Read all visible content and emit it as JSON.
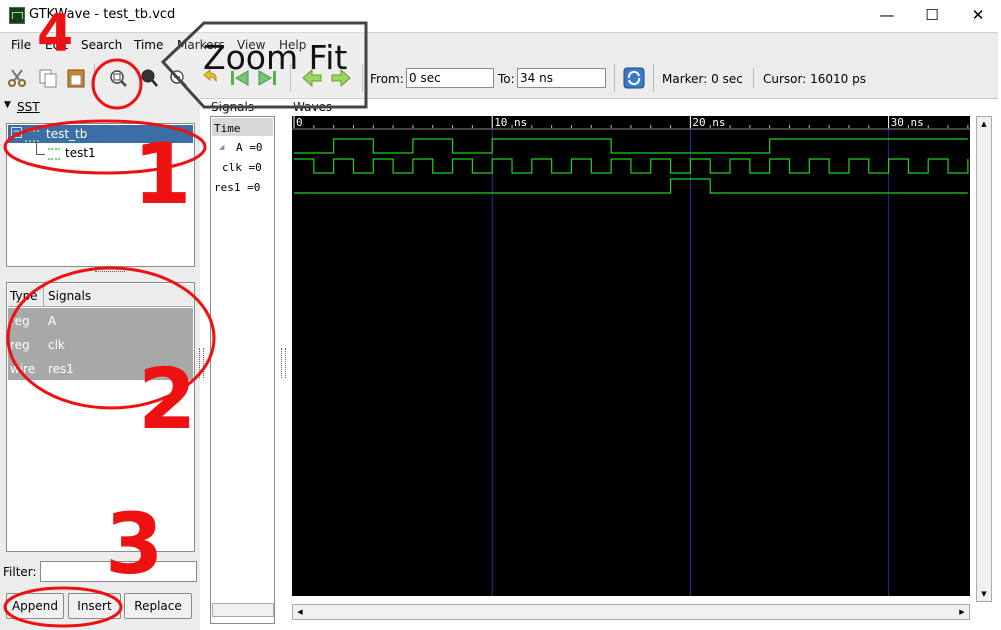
{
  "window": {
    "title": "GTKWave - test_tb.vcd",
    "controls": [
      "—",
      "☐",
      "✕"
    ]
  },
  "menu": [
    "File",
    "Edit",
    "Search",
    "Time",
    "Markers",
    "View",
    "Help"
  ],
  "toolbar": {
    "from_label": "From:",
    "from_value": "0 sec",
    "to_label": "To:",
    "to_value": "34 ns",
    "marker_text": "Marker: 0 sec",
    "cursor_text": "Cursor: 16010 ps",
    "icons": [
      "cut-icon",
      "copy-icon",
      "paste-icon",
      "zoom-fit-icon",
      "zoom-in-icon",
      "zoom-out-icon",
      "undo-icon",
      "zoom-start-icon",
      "zoom-end-icon",
      "prev-edge-icon",
      "next-edge-icon",
      "reload-icon"
    ]
  },
  "sst": {
    "header": "SST",
    "tree": [
      {
        "label": "test_tb",
        "selected": true
      },
      {
        "label": "test1",
        "selected": false
      }
    ],
    "columns": {
      "type": "Type",
      "signals": "Signals"
    },
    "signals": [
      {
        "type": "reg",
        "name": "A"
      },
      {
        "type": "reg",
        "name": "clk"
      },
      {
        "type": "wire",
        "name": "res1"
      }
    ],
    "filter_label": "Filter:",
    "filter_value": "",
    "buttons": {
      "append": "Append",
      "insert": "Insert",
      "replace": "Replace"
    }
  },
  "signals_pane": {
    "header": "Signals",
    "rows": [
      {
        "label": "Time"
      },
      {
        "label": "A =0"
      },
      {
        "label": "clk =0"
      },
      {
        "label": "res1 =0"
      }
    ]
  },
  "waves_pane": {
    "header": "Waves",
    "time_labels": [
      "0",
      "10 ns",
      "20 ns",
      "30 ns"
    ],
    "time_span_ns": 34,
    "waveforms": {
      "A": [
        [
          0,
          0
        ],
        [
          2,
          1
        ],
        [
          4,
          0
        ],
        [
          6,
          1
        ],
        [
          8,
          0
        ],
        [
          10,
          1
        ],
        [
          16,
          0
        ],
        [
          24,
          1
        ]
      ],
      "clk": [
        [
          0,
          1
        ],
        [
          1,
          0
        ],
        [
          2,
          1
        ],
        [
          3,
          0
        ],
        [
          4,
          1
        ],
        [
          5,
          0
        ],
        [
          6,
          1
        ],
        [
          7,
          0
        ],
        [
          8,
          1
        ],
        [
          9,
          0
        ],
        [
          10,
          1
        ],
        [
          11,
          0
        ],
        [
          12,
          1
        ],
        [
          13,
          0
        ],
        [
          14,
          1
        ],
        [
          15,
          0
        ],
        [
          16,
          1
        ],
        [
          17,
          0
        ],
        [
          18,
          1
        ],
        [
          19,
          0
        ],
        [
          20,
          1
        ],
        [
          21,
          0
        ],
        [
          22,
          1
        ],
        [
          23,
          0
        ],
        [
          24,
          1
        ],
        [
          25,
          0
        ],
        [
          26,
          1
        ],
        [
          27,
          0
        ],
        [
          28,
          1
        ],
        [
          29,
          0
        ],
        [
          30,
          1
        ],
        [
          31,
          0
        ],
        [
          32,
          1
        ],
        [
          33,
          0
        ],
        [
          34,
          1
        ]
      ],
      "res1": [
        [
          0,
          0
        ],
        [
          19,
          1
        ],
        [
          21,
          0
        ]
      ]
    }
  },
  "annotations": {
    "numbers": [
      "1",
      "2",
      "3",
      "4"
    ],
    "callout": "Zoom Fit",
    "colors": {
      "annotation_red": "#ee1111",
      "wave_green": "#22d022",
      "grid_blue": "#2828a8",
      "selection_blue": "#3a6ea5",
      "row_gray": "#a8a8a8"
    }
  }
}
